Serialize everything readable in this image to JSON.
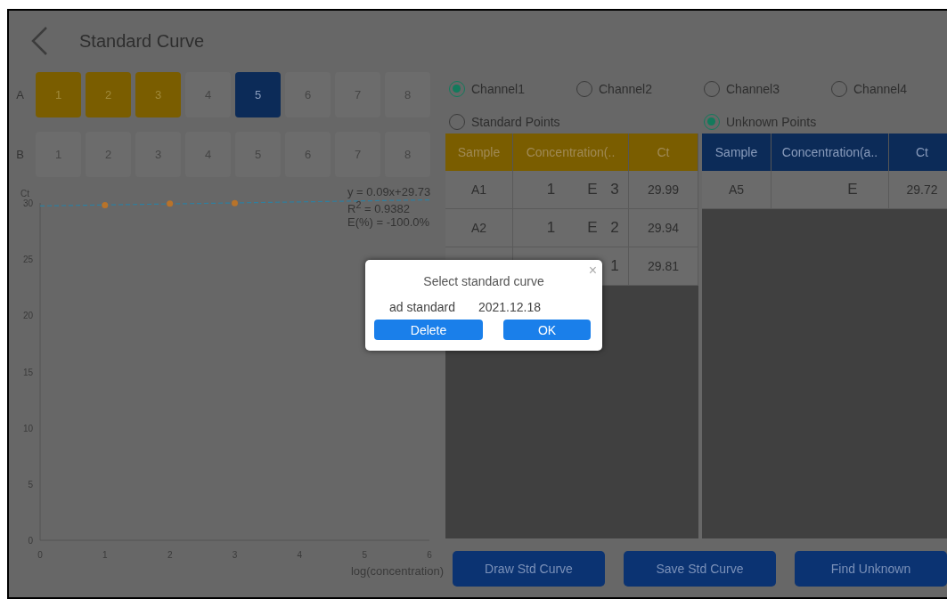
{
  "header": {
    "title": "Standard Curve"
  },
  "plate": {
    "rows": [
      {
        "label": "A",
        "wells": [
          {
            "label": "1",
            "kind": "standard"
          },
          {
            "label": "2",
            "kind": "standard"
          },
          {
            "label": "3",
            "kind": "standard"
          },
          {
            "label": "4",
            "kind": "empty"
          },
          {
            "label": "5",
            "kind": "unknown"
          },
          {
            "label": "6",
            "kind": "empty"
          },
          {
            "label": "7",
            "kind": "empty"
          },
          {
            "label": "8",
            "kind": "empty"
          }
        ]
      },
      {
        "label": "B",
        "wells": [
          {
            "label": "1",
            "kind": "empty"
          },
          {
            "label": "2",
            "kind": "empty"
          },
          {
            "label": "3",
            "kind": "empty"
          },
          {
            "label": "4",
            "kind": "empty"
          },
          {
            "label": "5",
            "kind": "empty"
          },
          {
            "label": "6",
            "kind": "empty"
          },
          {
            "label": "7",
            "kind": "empty"
          },
          {
            "label": "8",
            "kind": "empty"
          }
        ]
      }
    ]
  },
  "chart": {
    "chart_data": {
      "type": "scatter",
      "xlabel": "log(concentration)",
      "ylabel": "Ct",
      "x": [
        1,
        2,
        3
      ],
      "series": [
        {
          "color": "#b8732a",
          "values": [
            29.81,
            29.94,
            29.99
          ]
        }
      ],
      "xlim": [
        0,
        6
      ],
      "ylim": [
        0,
        30
      ],
      "xticks": [
        0,
        1,
        2,
        3,
        4,
        5,
        6
      ],
      "yticks": [
        0,
        5,
        10,
        15,
        20,
        25,
        30
      ],
      "annotations": [
        "y = 0.09x+29.73",
        "R$^{2}$ = 0.9382",
        "E(%) = -100.0%"
      ]
    }
  },
  "channels": [
    {
      "label": "Channel1",
      "selected": true
    },
    {
      "label": "Channel2",
      "selected": false
    },
    {
      "label": "Channel3",
      "selected": false
    },
    {
      "label": "Channel4",
      "selected": false
    }
  ],
  "point_types": [
    {
      "label": "Standard Points",
      "selected": false
    },
    {
      "label": "Unknown Points",
      "selected": true
    }
  ],
  "standard_table": {
    "columns": [
      "Sample",
      "Concentration(..",
      "Ct"
    ],
    "rows": [
      {
        "sample": "A1",
        "concentration": {
          "coefficient": "1",
          "e": "E",
          "exponent": "3"
        },
        "ct": "29.99"
      },
      {
        "sample": "A2",
        "concentration": {
          "coefficient": "1",
          "e": "E",
          "exponent": "2"
        },
        "ct": "29.94"
      },
      {
        "concentration": {
          "exponent": "1"
        },
        "ct": "29.81"
      }
    ]
  },
  "unknown_table": {
    "columns": [
      "Sample",
      "Concentration(a..",
      "Ct"
    ],
    "rows": [
      {
        "sample": "A5",
        "concentration": {
          "e": "E"
        },
        "ct": "29.72"
      }
    ]
  },
  "buttons": [
    "Draw Std Curve",
    "Save Std Curve",
    "Find Unknown"
  ],
  "dialog": {
    "title": "Select standard curve",
    "close": "×",
    "entry": {
      "name": "ad  standard",
      "date": "2021.12.18"
    },
    "buttons": [
      "Delete",
      "OK"
    ]
  }
}
